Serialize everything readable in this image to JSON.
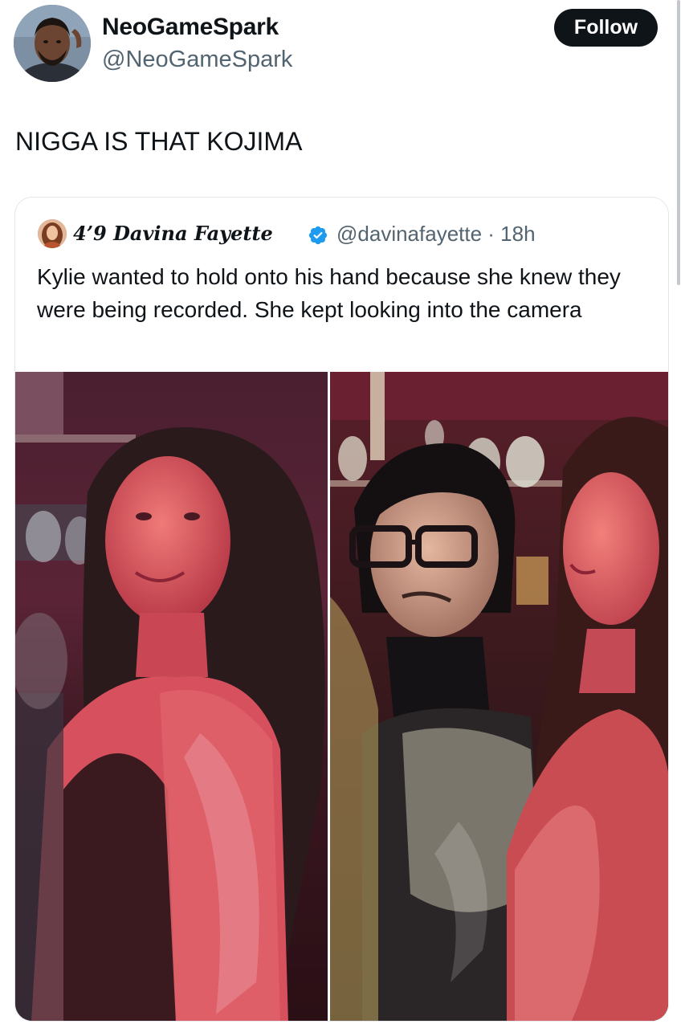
{
  "tweet": {
    "display_name": "NeoGameSpark",
    "handle": "@NeoGameSpark",
    "follow_label": "Follow",
    "text": "NIGGA IS THAT KOJIMA"
  },
  "quoted": {
    "display_name": "4’9 Davina Fayette",
    "verified": true,
    "meta": "@davinafayette · 18h",
    "text": "Kylie wanted to hold onto his hand because she knew they were being recorded. She kept looking into the camera"
  },
  "icons": {
    "verified": "verified-badge-icon"
  },
  "colors": {
    "follow_button_bg": "#0f1419",
    "secondary_text": "#536471",
    "verified_blue": "#1d9bf0"
  }
}
